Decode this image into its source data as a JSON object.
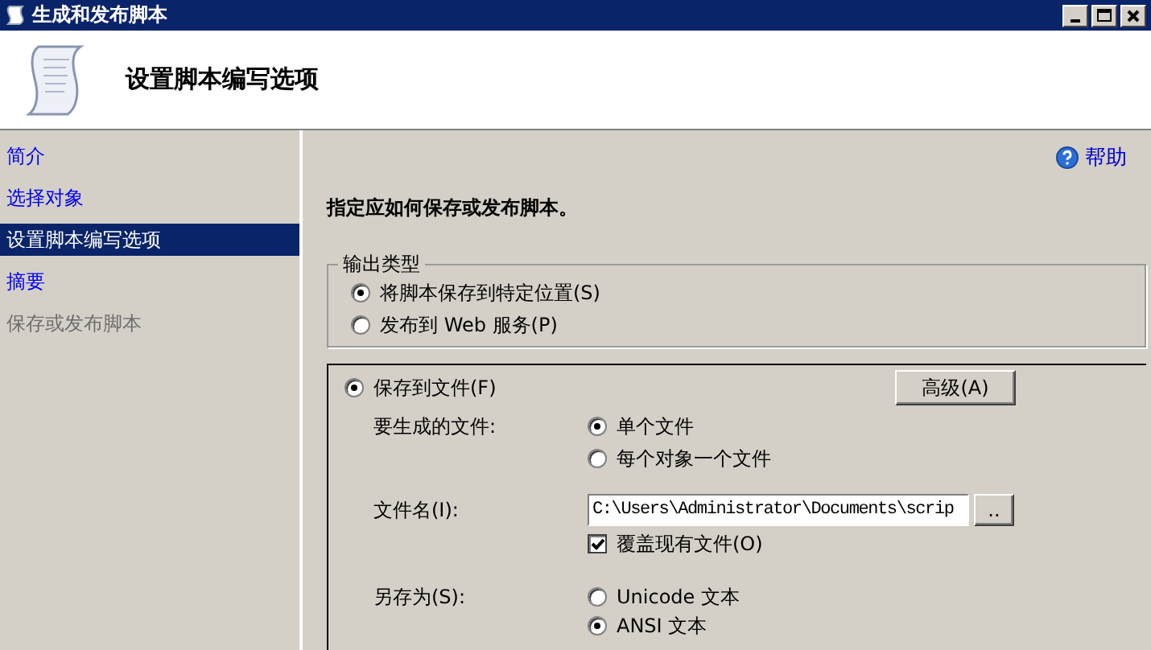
{
  "window": {
    "title": "生成和发布脚本"
  },
  "header": {
    "title": "设置脚本编写选项"
  },
  "sidebar": {
    "items": [
      {
        "label": "简介",
        "selected": false,
        "disabled": false
      },
      {
        "label": "选择对象",
        "selected": false,
        "disabled": false
      },
      {
        "label": "设置脚本编写选项",
        "selected": true,
        "disabled": false
      },
      {
        "label": "摘要",
        "selected": false,
        "disabled": false
      },
      {
        "label": "保存或发布脚本",
        "selected": false,
        "disabled": true
      }
    ]
  },
  "help": {
    "label": "帮助"
  },
  "prompt": "指定应如何保存或发布脚本。",
  "output_type": {
    "legend": "输出类型",
    "options": [
      {
        "label": "将脚本保存到特定位置(S)",
        "selected": true
      },
      {
        "label": "发布到 Web 服务(P)",
        "selected": false
      }
    ]
  },
  "save_to_file": {
    "label": "保存到文件(F)",
    "selected": true,
    "advanced_button": "高级(A)",
    "files_to_generate": {
      "label": "要生成的文件:",
      "options": [
        {
          "label": "单个文件",
          "selected": true
        },
        {
          "label": "每个对象一个文件",
          "selected": false
        }
      ]
    },
    "file_name": {
      "label": "文件名(I):",
      "value": "C:\\Users\\Administrator\\Documents\\scrip",
      "browse_button": ".."
    },
    "overwrite": {
      "label": "覆盖现有文件(O)",
      "checked": true
    },
    "save_as": {
      "label": "另存为(S):",
      "options": [
        {
          "label": "Unicode 文本",
          "selected": false
        },
        {
          "label": "ANSI 文本",
          "selected": true
        }
      ]
    }
  }
}
